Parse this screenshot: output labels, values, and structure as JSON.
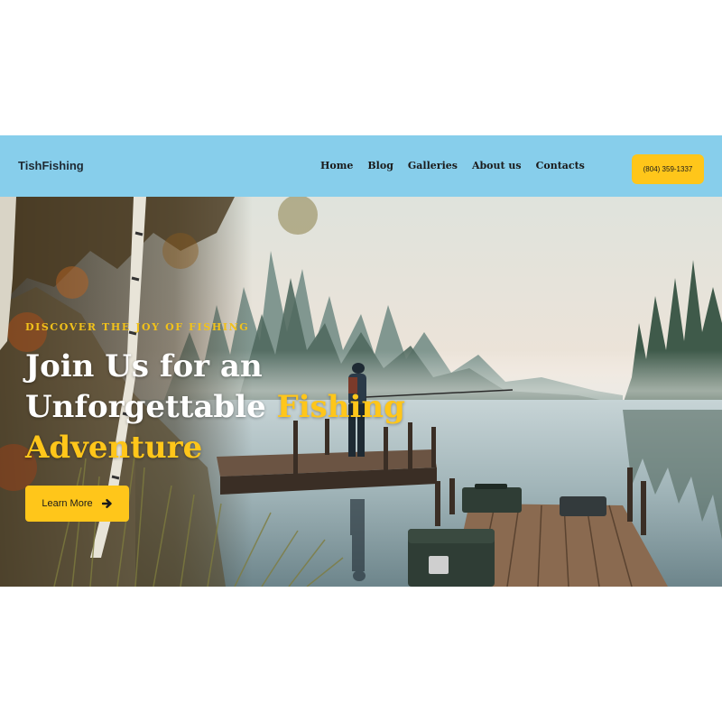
{
  "header": {
    "logo": "TishFishing",
    "nav": [
      "Home",
      "Blog",
      "Galleries",
      "About us",
      "Contacts"
    ],
    "phone": "(804) 359-1337"
  },
  "hero": {
    "eyebrow": "DISCOVER THE JOY OF FISHING",
    "headline_part1": "Join Us for an Unforgettable ",
    "headline_accent": "Fishing Adventure",
    "button_label": "Learn More",
    "button_icon": "arrow-right-icon",
    "image": "fisherman-on-dock-misty-lake"
  },
  "colors": {
    "header_bg": "#87ceeb",
    "accent": "#ffc61a",
    "text_light": "#ffffff",
    "text_dark": "#1b1b1b"
  }
}
